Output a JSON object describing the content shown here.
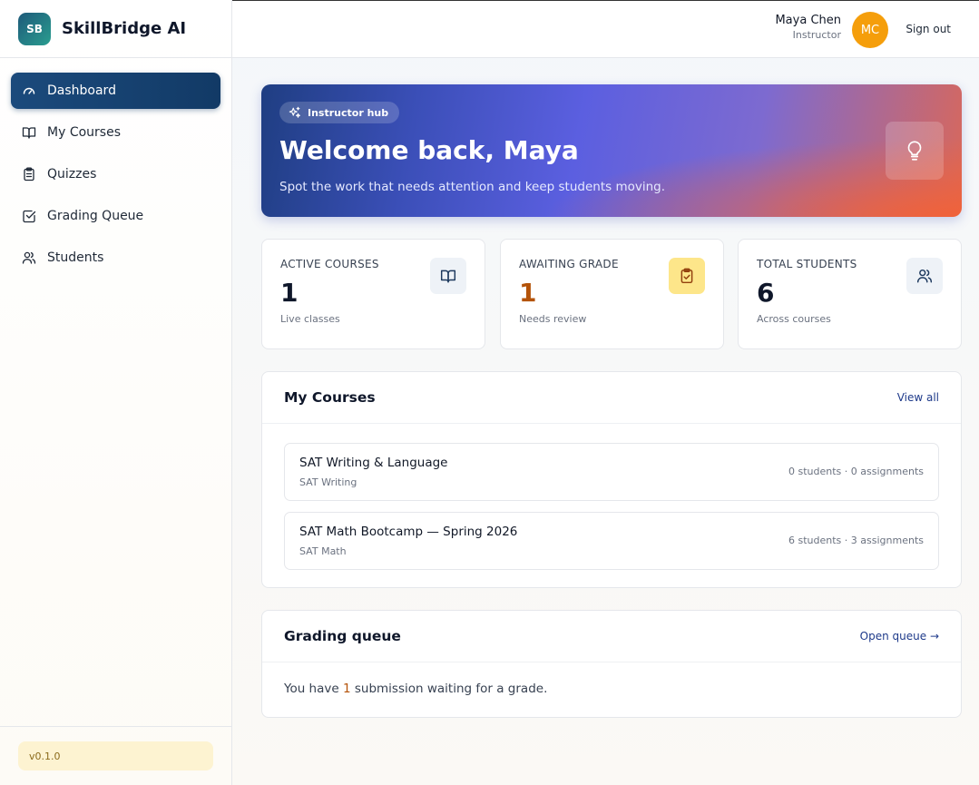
{
  "app": {
    "logo_text": "SB",
    "name": "SkillBridge AI",
    "version": "v0.1.0"
  },
  "sidebar": {
    "items": [
      {
        "label": "Dashboard",
        "icon": "gauge-icon",
        "active": true
      },
      {
        "label": "My Courses",
        "icon": "book-icon"
      },
      {
        "label": "Quizzes",
        "icon": "clipboard-icon"
      },
      {
        "label": "Grading Queue",
        "icon": "check-square-icon"
      },
      {
        "label": "Students",
        "icon": "users-icon"
      }
    ]
  },
  "header": {
    "user_name": "Maya Chen",
    "user_role": "Instructor",
    "avatar_initials": "MC",
    "signout_label": "Sign out"
  },
  "hero": {
    "badge": "Instructor hub",
    "title": "Welcome back, Maya",
    "subtitle": "Spot the work that needs attention and keep students moving.",
    "icon": "lightbulb-icon"
  },
  "stats": [
    {
      "label": "ACTIVE COURSES",
      "value": "1",
      "caption": "Live classes",
      "icon": "book-icon"
    },
    {
      "label": "AWAITING GRADE",
      "value": "1",
      "caption": "Needs review",
      "icon": "clipboard-check-icon",
      "accent": "#b45309"
    },
    {
      "label": "TOTAL STUDENTS",
      "value": "6",
      "caption": "Across courses",
      "icon": "users-icon"
    }
  ],
  "courses_card": {
    "title": "My Courses",
    "link": "View all",
    "courses": [
      {
        "name": "SAT Writing & Language",
        "subject": "SAT Writing",
        "meta": "0 students · 0 assignments"
      },
      {
        "name": "SAT Math Bootcamp — Spring 2026",
        "subject": "SAT Math",
        "meta": "6 students · 3 assignments"
      }
    ]
  },
  "queue_card": {
    "title": "Grading queue",
    "link": "Open queue →",
    "text_before": "You have ",
    "count": "1",
    "text_after": " submission waiting for a grade."
  },
  "colors": {
    "brand_navy": "#123a66",
    "accent_amber": "#f59e0b",
    "link": "#1e3a8a"
  }
}
